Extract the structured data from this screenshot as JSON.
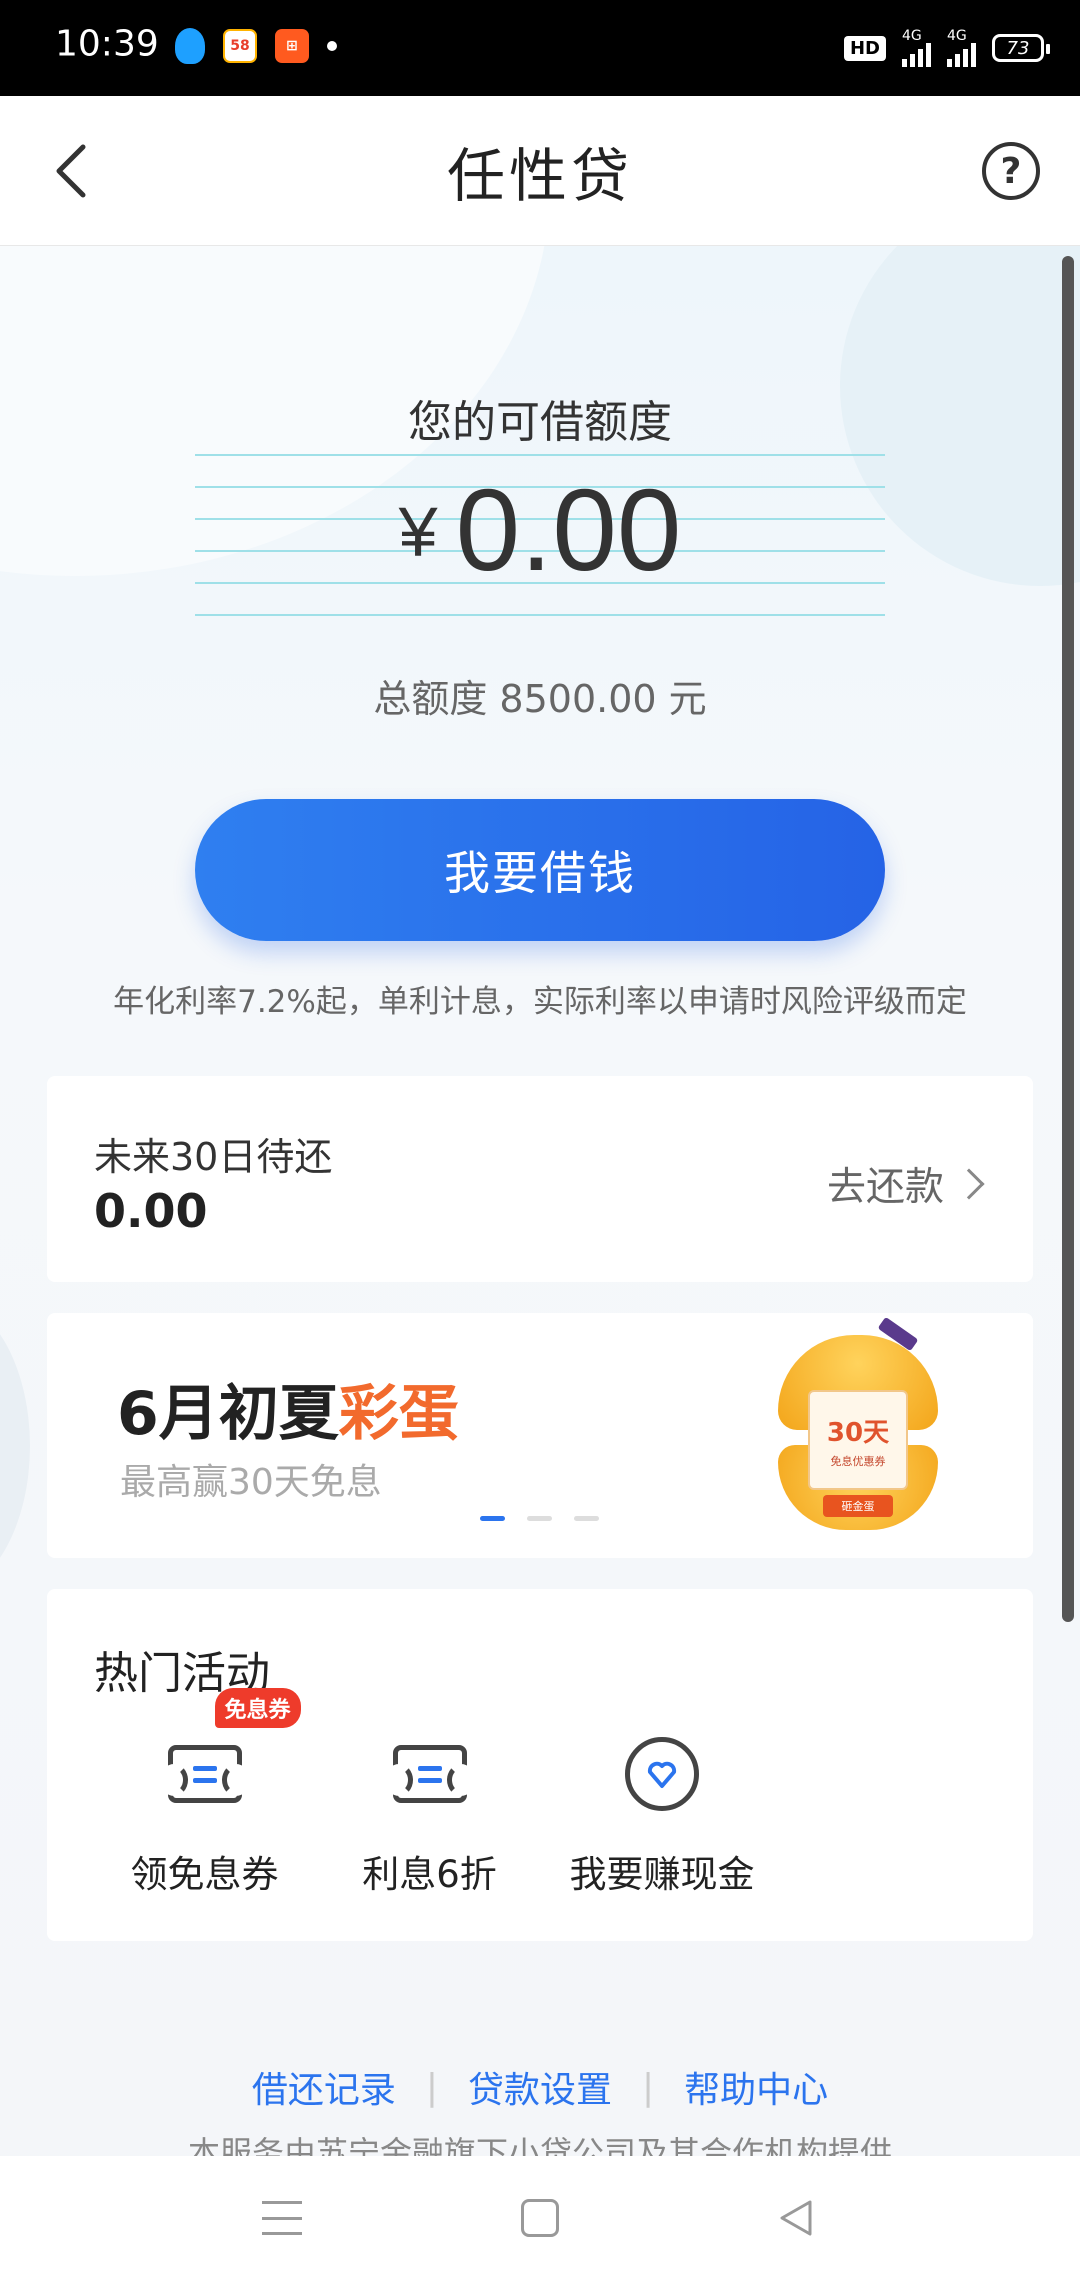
{
  "status_bar": {
    "time": "10:39",
    "app_58_label": "58",
    "hd_label": "HD",
    "signal_1_label": "4G",
    "signal_2_label": "4G",
    "battery": "73"
  },
  "header": {
    "title": "任性贷"
  },
  "quota": {
    "label": "您的可借额度",
    "currency": "¥",
    "amount": "0.00",
    "total": "总额度 8500.00 元"
  },
  "borrow_button_label": "我要借钱",
  "rate_note": "年化利率7.2%起，单利计息，实际利率以申请时风险评级而定",
  "repay_card": {
    "label": "未来30日待还",
    "value": "0.00",
    "link_label": "去还款"
  },
  "banner": {
    "title_main": "6月初夏",
    "title_highlight": "彩蛋",
    "subtitle": "最高赢30天免息",
    "egg_days": "30天",
    "egg_desc": "免息优惠券",
    "egg_band": "砸金蛋",
    "active_dot": 0
  },
  "hot_activities": {
    "title": "热门活动",
    "items": [
      {
        "label": "领免息券",
        "badge": "免息券",
        "icon": "coupon-icon"
      },
      {
        "label": "利息6折",
        "icon": "coupon-icon"
      },
      {
        "label": "我要赚现金",
        "icon": "heart-circle-icon"
      }
    ]
  },
  "footer": {
    "links": [
      "借还记录",
      "贷款设置",
      "帮助中心"
    ],
    "note": "本服务由苏宁金融旗下小贷公司及其合作机构提供"
  },
  "colors": {
    "accent": "#2b74ee",
    "button_start": "#2f7ff0",
    "button_end": "#2563e6",
    "highlight": "#f26a2d",
    "badge": "#ee3b2b"
  }
}
